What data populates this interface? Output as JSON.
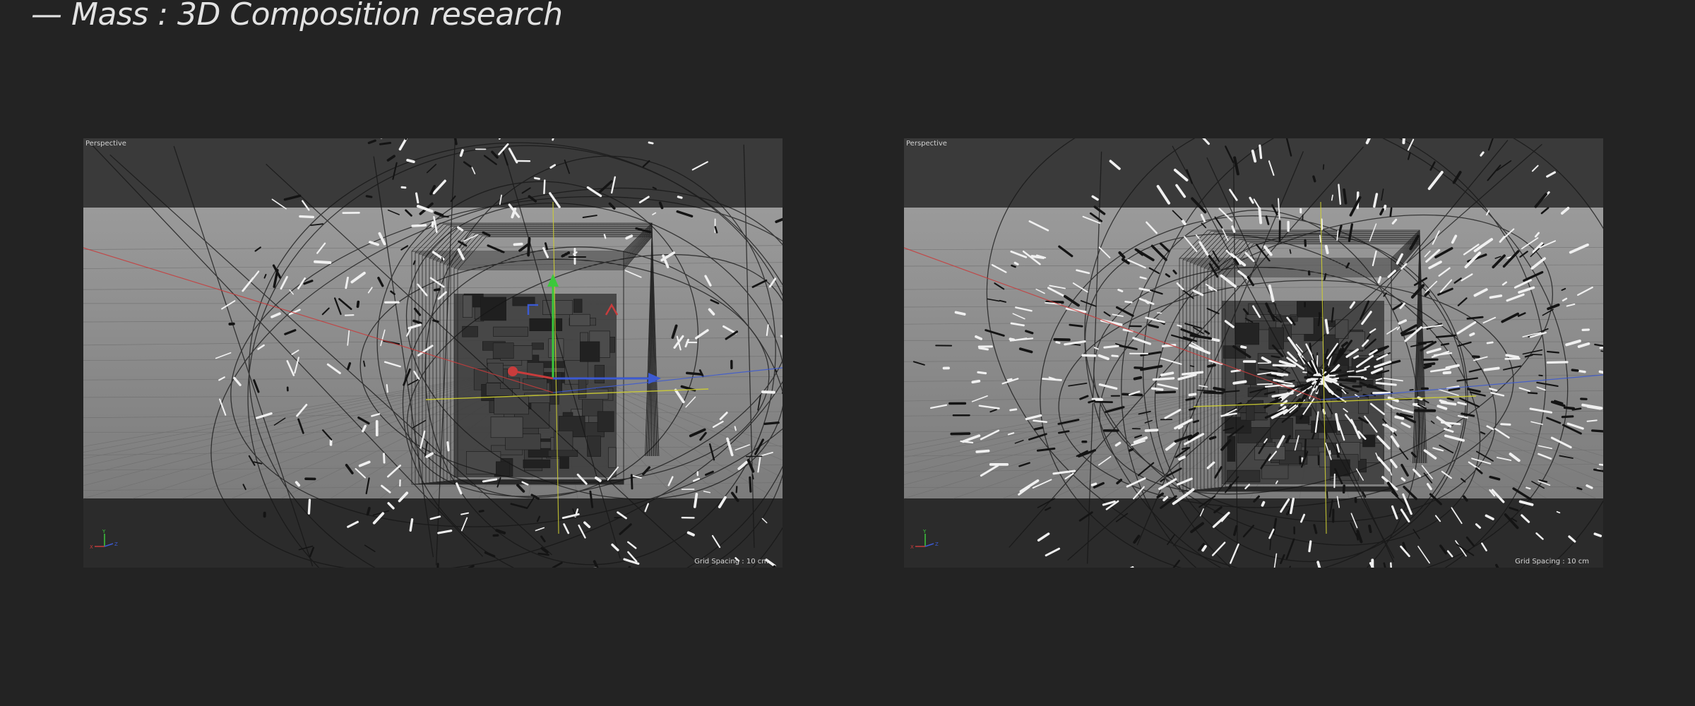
{
  "page": {
    "title": "— Mass : 3D Composition research"
  },
  "viewports": [
    {
      "label": "Perspective",
      "grid_spacing": "Grid Spacing : 10 cm"
    },
    {
      "label": "Perspective",
      "grid_spacing": "Grid Spacing : 10 cm"
    }
  ],
  "colors": {
    "background": "#232323",
    "floor": "#8c8c8c",
    "axis_x": "#c83c3c",
    "axis_y": "#3cc83c",
    "axis_z": "#3c5ad2",
    "guide": "#cfcf32"
  }
}
